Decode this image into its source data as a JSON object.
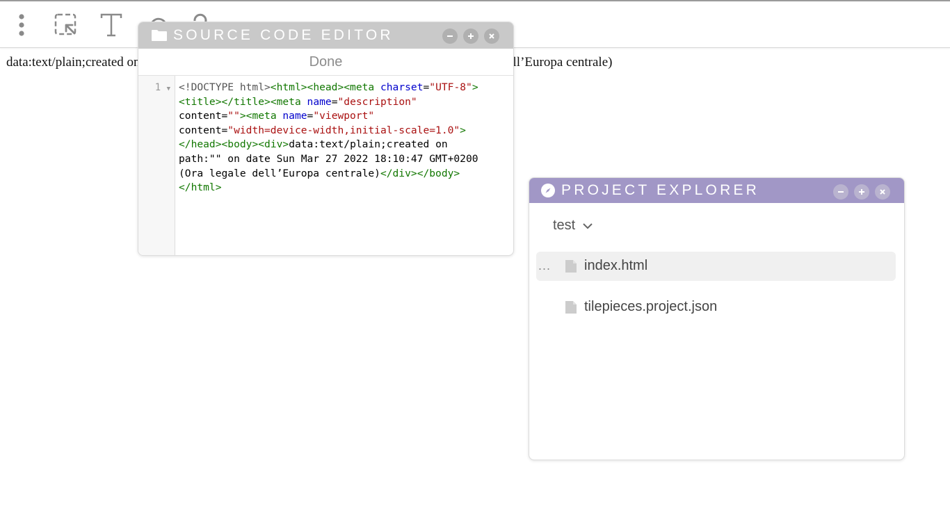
{
  "toolbar": {
    "items": [
      {
        "name": "more-menu",
        "icon": "vertical-dots-icon"
      },
      {
        "name": "select",
        "icon": "select-cursor-icon"
      },
      {
        "name": "text",
        "icon": "text-icon"
      },
      {
        "name": "undo",
        "icon": "undo-icon"
      },
      {
        "name": "help",
        "icon": "help-icon"
      }
    ]
  },
  "page": {
    "text": "data:text/plain;created on path:\"\" on date Sun Mar 27 2022 18:10:47 GMT+0200 (Ora legale dell’Europa centrale)"
  },
  "source_editor": {
    "title": "SOURCE CODE EDITOR",
    "icon": "folder-icon",
    "done_label": "Done",
    "line_number": "1",
    "code_lines": [
      "<!DOCTYPE html><html><head><meta charset=\"UTF-8\">",
      "<title></title><meta name=\"description\"",
      "content=\"\"><meta name=\"viewport\"",
      "content=\"width=device-width,initial-scale=1.0\">",
      "</head><body><div>data:text/plain;created on",
      "path:\"\" on date Sun Mar 27 2022 18:10:47 GMT+0200",
      "(Ora legale dell’Europa centrale)</div></body>",
      "</html>"
    ]
  },
  "project_explorer": {
    "title": "PROJECT EXPLORER",
    "icon": "compass-icon",
    "project_name": "test",
    "files": [
      {
        "name": "index.html",
        "selected": true,
        "menu": "..."
      },
      {
        "name": "tilepieces.project.json",
        "selected": false,
        "menu": ""
      }
    ]
  },
  "colors": {
    "editor_header": "#c9c9c9",
    "explorer_header": "#a197c6",
    "tag": "#117700",
    "attribute": "#0000cc",
    "string": "#aa1111"
  }
}
